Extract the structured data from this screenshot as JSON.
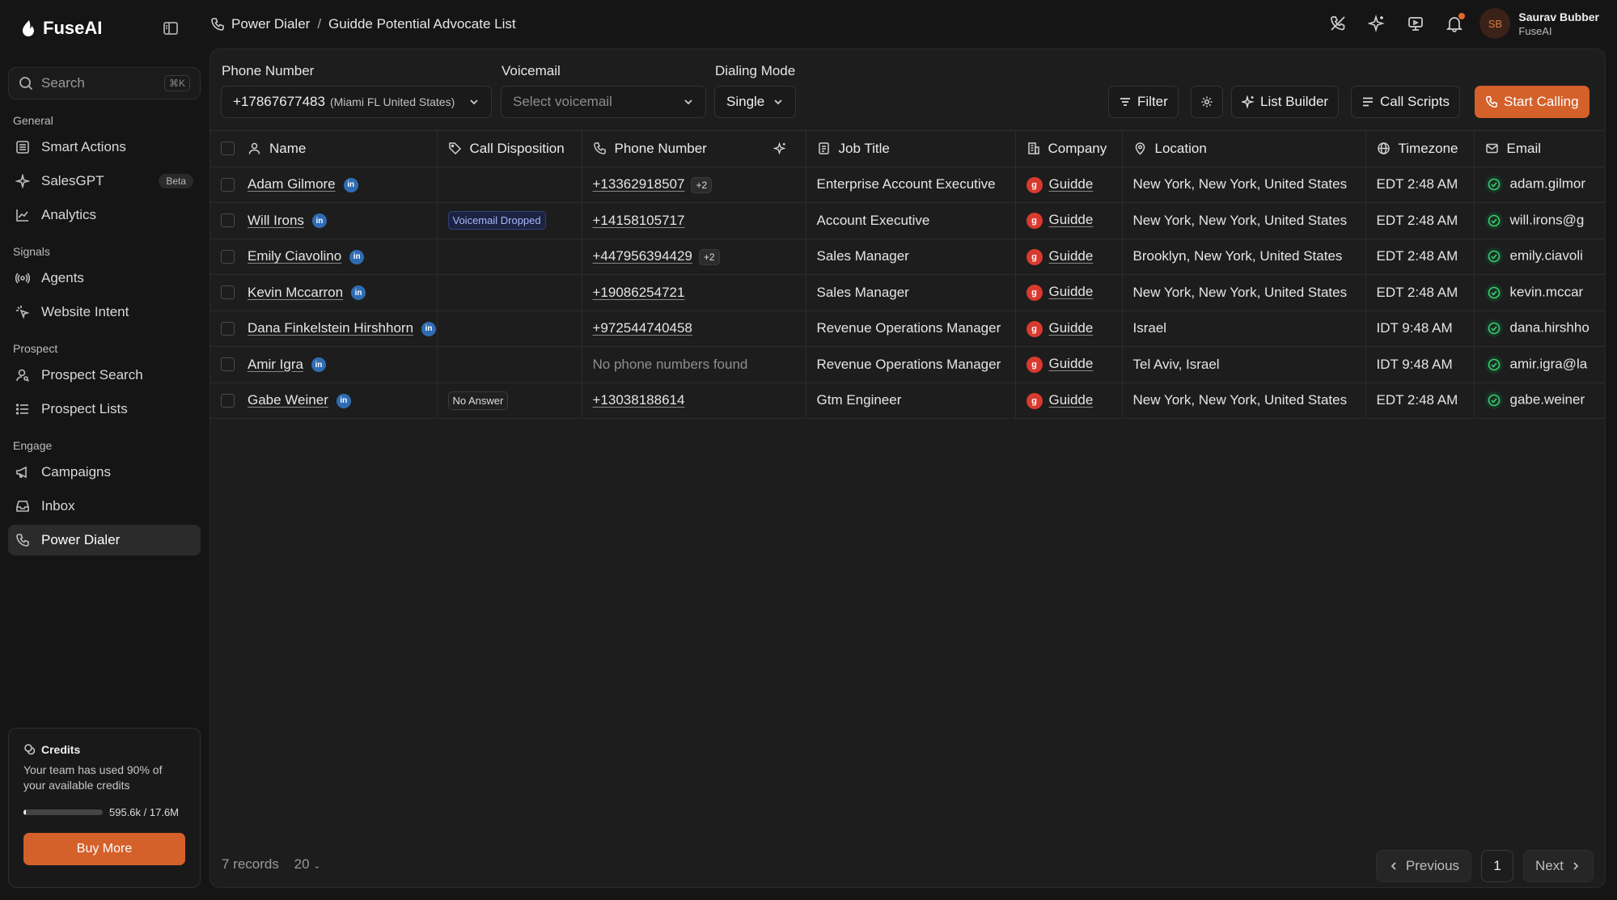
{
  "app": {
    "name": "FuseAI"
  },
  "sidebar": {
    "search_placeholder": "Search",
    "search_shortcut": "⌘K",
    "sections": {
      "general": "General",
      "signals": "Signals",
      "prospect": "Prospect",
      "engage": "Engage"
    },
    "items": {
      "smart_actions": "Smart Actions",
      "salesgpt": "SalesGPT",
      "salesgpt_badge": "Beta",
      "analytics": "Analytics",
      "agents": "Agents",
      "website_intent": "Website Intent",
      "prospect_search": "Prospect Search",
      "prospect_lists": "Prospect Lists",
      "campaigns": "Campaigns",
      "inbox": "Inbox",
      "power_dialer": "Power Dialer"
    },
    "credits": {
      "title": "Credits",
      "description": "Your team has used 90% of your available credits",
      "usage": "595.6k / 17.6M",
      "used_fraction": 0.034,
      "buy_label": "Buy More"
    }
  },
  "header": {
    "breadcrumb_root": "Power Dialer",
    "breadcrumb_separator": "/",
    "breadcrumb_current": "Guidde Potential Advocate List",
    "user_initials": "SB",
    "user_name": "Saurav Bubber",
    "user_org": "FuseAI"
  },
  "controls": {
    "phone_label": "Phone Number",
    "phone_value": "+17867677483",
    "phone_location": "(Miami FL United States)",
    "voicemail_label": "Voicemail",
    "voicemail_placeholder": "Select voicemail",
    "dialing_label": "Dialing Mode",
    "dialing_value": "Single",
    "filter": "Filter",
    "list_builder": "List Builder",
    "call_scripts": "Call Scripts",
    "start_calling": "Start Calling"
  },
  "table": {
    "columns": {
      "name": "Name",
      "disposition": "Call Disposition",
      "phone": "Phone Number",
      "job": "Job Title",
      "company": "Company",
      "location": "Location",
      "timezone": "Timezone",
      "email": "Email"
    },
    "rows": [
      {
        "name": "Adam Gilmore",
        "disposition": "",
        "phone": "+13362918507",
        "phone_extra": "+2",
        "job": "Enterprise Account Executive",
        "company": "Guidde",
        "location": "New York, New York, United States",
        "timezone": "EDT 2:48 AM",
        "email": "adam.gilmor"
      },
      {
        "name": "Will Irons",
        "disposition": "Voicemail Dropped",
        "phone": "+14158105717",
        "phone_extra": "",
        "job": "Account Executive",
        "company": "Guidde",
        "location": "New York, New York, United States",
        "timezone": "EDT 2:48 AM",
        "email": "will.irons@g"
      },
      {
        "name": "Emily Ciavolino",
        "disposition": "",
        "phone": "+447956394429",
        "phone_extra": "+2",
        "job": "Sales Manager",
        "company": "Guidde",
        "location": "Brooklyn, New York, United States",
        "timezone": "EDT 2:48 AM",
        "email": "emily.ciavoli"
      },
      {
        "name": "Kevin Mccarron",
        "disposition": "",
        "phone": "+19086254721",
        "phone_extra": "",
        "job": "Sales Manager",
        "company": "Guidde",
        "location": "New York, New York, United States",
        "timezone": "EDT 2:48 AM",
        "email": "kevin.mccar"
      },
      {
        "name": "Dana Finkelstein Hirshhorn",
        "disposition": "",
        "phone": "+972544740458",
        "phone_extra": "",
        "job": "Revenue Operations Manager",
        "company": "Guidde",
        "location": "Israel",
        "timezone": "IDT 9:48 AM",
        "email": "dana.hirshho"
      },
      {
        "name": "Amir Igra",
        "disposition": "",
        "phone": "No phone numbers found",
        "phone_extra": "",
        "job": "Revenue Operations Manager",
        "company": "Guidde",
        "location": "Tel Aviv, Israel",
        "timezone": "IDT 9:48 AM",
        "email": "amir.igra@la"
      },
      {
        "name": "Gabe Weiner",
        "disposition": "No Answer",
        "phone": "+13038188614",
        "phone_extra": "",
        "job": "Gtm Engineer",
        "company": "Guidde",
        "location": "New York, New York, United States",
        "timezone": "EDT 2:48 AM",
        "email": "gabe.weiner"
      }
    ],
    "linkedin_glyph": "in"
  },
  "footer": {
    "records": "7 records",
    "page_size": "20",
    "previous": "Previous",
    "current_page": "1",
    "next": "Next"
  },
  "colors": {
    "accent": "#d4602a",
    "linkedin": "#2f6cb3",
    "verified": "#3bcf73"
  }
}
